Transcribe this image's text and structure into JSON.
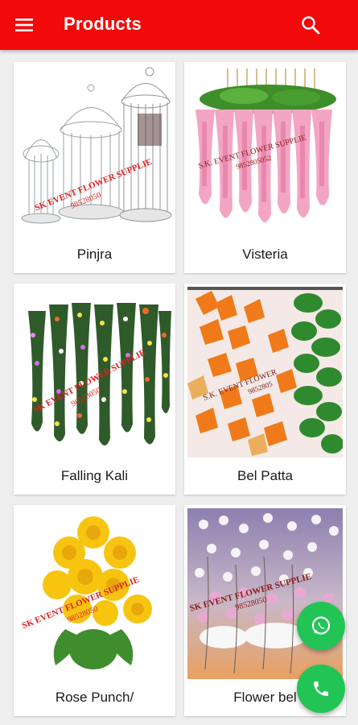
{
  "app_bar": {
    "title": "Products",
    "menu_icon": "hamburger-menu-icon",
    "search_icon": "search-icon",
    "background": "#f20a0a"
  },
  "products": [
    {
      "name": "Pinjra",
      "watermark": [
        "SK EVENT FLOWER SUPPLIE",
        "98528050"
      ]
    },
    {
      "name": "Visteria",
      "watermark": [
        "S.K. EVENT FLOWER SUPPLIE",
        "9852805052"
      ]
    },
    {
      "name": "Falling Kali",
      "watermark": [
        "SK EVENT FLOWER SUPPLIE",
        "98528050"
      ]
    },
    {
      "name": "Bel Patta",
      "watermark": [
        "S.K. EVENT FLOWER",
        "9852805"
      ]
    },
    {
      "name": "Rose Punch/",
      "watermark": [
        "SK EVENT FLOWER SUPPLIE",
        "98528050"
      ]
    },
    {
      "name": "Flower bel",
      "watermark": [
        "SK EVENT FLOWER SUPPLIE",
        "98528050"
      ]
    }
  ],
  "fabs": {
    "whatsapp_icon": "whatsapp-icon",
    "call_icon": "phone-icon",
    "color": "#23c456"
  }
}
